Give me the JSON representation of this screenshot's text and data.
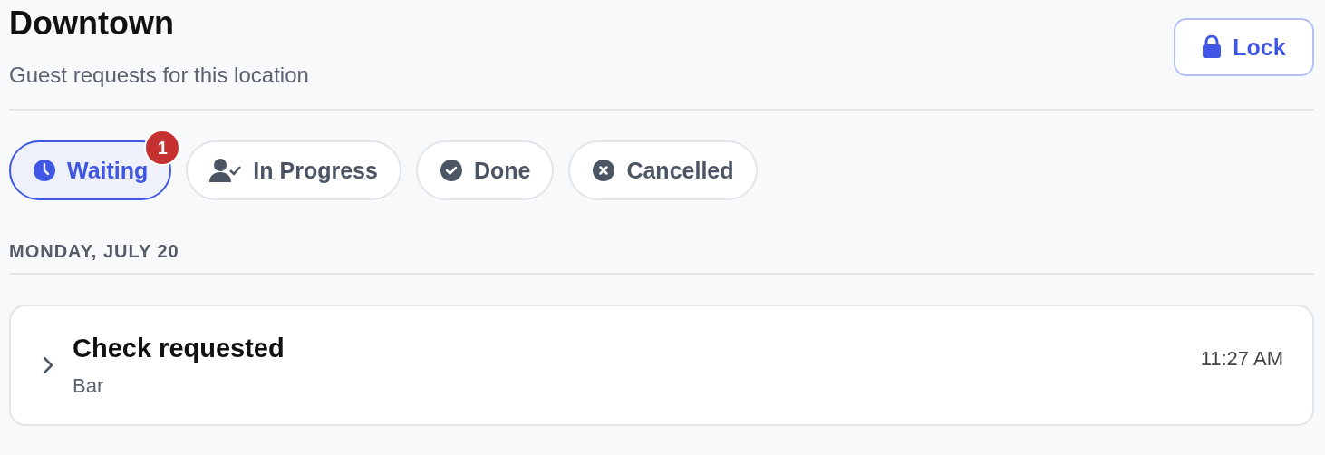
{
  "header": {
    "title": "Downtown",
    "subtitle": "Guest requests for this location",
    "lock_button": {
      "label": "Lock"
    }
  },
  "tabs": [
    {
      "kind": "clock",
      "label": "Waiting",
      "selected": true,
      "badge": "1"
    },
    {
      "kind": "person-check",
      "label": "In Progress",
      "selected": false
    },
    {
      "kind": "check",
      "label": "Done",
      "selected": false
    },
    {
      "kind": "cross",
      "label": "Cancelled",
      "selected": false
    }
  ],
  "groups": [
    {
      "date": "MONDAY, JULY 20",
      "requests": [
        {
          "title": "Check requested",
          "place": "Bar",
          "time": "11:27 AM",
          "expanded": false
        }
      ]
    }
  ]
}
